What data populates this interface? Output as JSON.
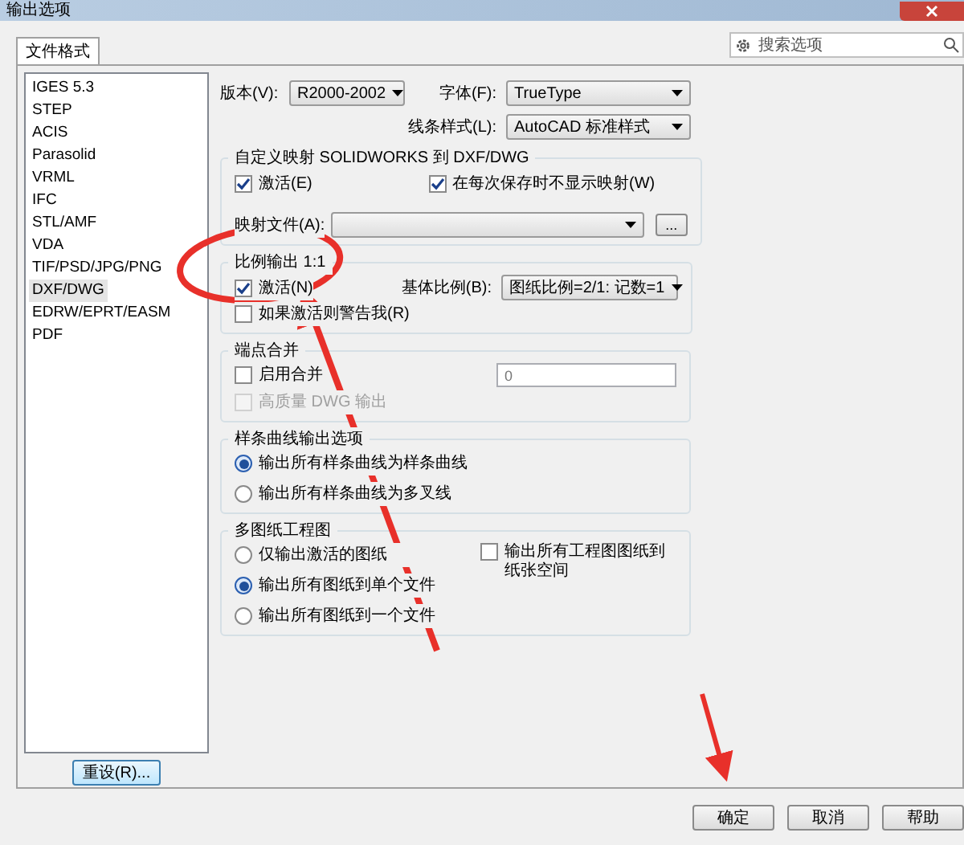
{
  "window": {
    "title": "输出选项"
  },
  "tabs": [
    {
      "label": "文件格式",
      "selected": true
    }
  ],
  "search": {
    "placeholder": "搜索选项"
  },
  "formats": [
    {
      "label": "IGES 5.3",
      "selected": false
    },
    {
      "label": "STEP",
      "selected": false
    },
    {
      "label": "ACIS",
      "selected": false
    },
    {
      "label": "Parasolid",
      "selected": false
    },
    {
      "label": "VRML",
      "selected": false
    },
    {
      "label": "IFC",
      "selected": false
    },
    {
      "label": "STL/AMF",
      "selected": false
    },
    {
      "label": "VDA",
      "selected": false
    },
    {
      "label": "TIF/PSD/JPG/PNG",
      "selected": false
    },
    {
      "label": "DXF/DWG",
      "selected": true
    },
    {
      "label": "EDRW/EPRT/EASM",
      "selected": false
    },
    {
      "label": "PDF",
      "selected": false
    }
  ],
  "reset_button": "重设(R)...",
  "version": {
    "label": "版本(V):",
    "value": "R2000-2002"
  },
  "font": {
    "label": "字体(F):",
    "value": "TrueType"
  },
  "line_style": {
    "label": "线条样式(L):",
    "value": "AutoCAD 标准样式"
  },
  "mapping": {
    "title": "自定义映射 SOLIDWORKS 到 DXF/DWG",
    "activate": {
      "label": "激活(E)",
      "checked": true
    },
    "hide_on_save": {
      "label": "在每次保存时不显示映射(W)",
      "checked": true
    },
    "map_file": {
      "label": "映射文件(A):"
    },
    "browse_button": "..."
  },
  "scale": {
    "title": "比例输出 1:1",
    "activate": {
      "label": "激活(N)",
      "checked": true
    },
    "warn": {
      "label": "如果激活则警告我(R)",
      "checked": false
    },
    "base_scale": {
      "label": "基体比例(B):",
      "value": "图纸比例=2/1: 记数=1"
    }
  },
  "merge": {
    "title": "端点合并",
    "enable": {
      "label": "启用合并",
      "checked": false
    },
    "tolerance": "0",
    "hq": {
      "label": "高质量 DWG 输出",
      "checked": false,
      "disabled": true
    }
  },
  "spline": {
    "title": "样条曲线输出选项",
    "options": [
      {
        "label": "输出所有样条曲线为样条曲线",
        "selected": true
      },
      {
        "label": "输出所有样条曲线为多叉线",
        "selected": false
      }
    ]
  },
  "sheets": {
    "title": "多图纸工程图",
    "options": [
      {
        "label": "仅输出激活的图纸",
        "selected": false
      },
      {
        "label": "输出所有图纸到单个文件",
        "selected": true
      },
      {
        "label": "输出所有图纸到一个文件",
        "selected": false
      }
    ],
    "paper_space": {
      "label": "输出所有工程图图纸到纸张空间",
      "checked": false
    }
  },
  "buttons": [
    "确定",
    "取消",
    "帮助"
  ]
}
